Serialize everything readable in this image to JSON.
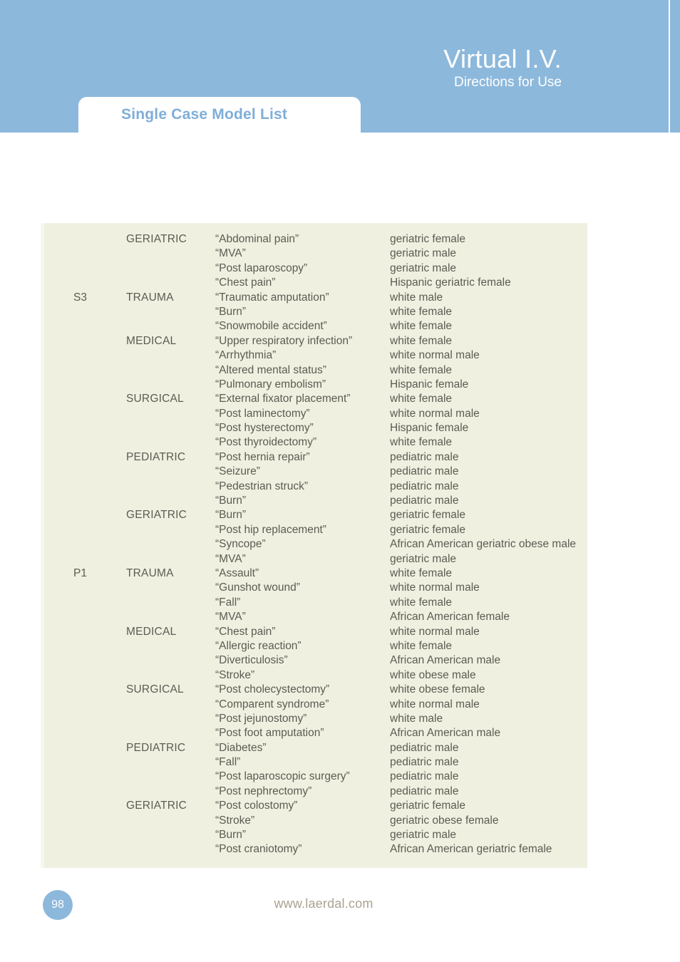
{
  "header": {
    "brand_title": "Virtual I.V.",
    "brand_subtitle": "Directions for Use",
    "tab_label": "Single Case Model List",
    "background_color": "#8cb8dc",
    "tab_text_color": "#7faed8"
  },
  "footer": {
    "page_number": "98",
    "site_url": "www.laerdal.com",
    "badge_color": "#8cb8dc"
  },
  "table": {
    "background_color": "#f0f0e1",
    "text_color": "#5b5b52",
    "rows": [
      {
        "code": "",
        "category": "GERIATRIC",
        "case": "“Abdominal pain”",
        "description": "geriatric female"
      },
      {
        "code": "",
        "category": "",
        "case": "“MVA”",
        "description": "geriatric male"
      },
      {
        "code": "",
        "category": "",
        "case": "“Post laparoscopy”",
        "description": "geriatric male"
      },
      {
        "code": "",
        "category": "",
        "case": "“Chest pain”",
        "description": "Hispanic geriatric female"
      },
      {
        "code": "S3",
        "category": "TRAUMA",
        "case": "“Traumatic amputation”",
        "description": "white male"
      },
      {
        "code": "",
        "category": "",
        "case": "“Burn”",
        "description": "white female"
      },
      {
        "code": "",
        "category": "",
        "case": "“Snowmobile accident”",
        "description": "white female"
      },
      {
        "code": "",
        "category": "MEDICAL",
        "case": "“Upper respiratory infection”",
        "description": "white female"
      },
      {
        "code": "",
        "category": "",
        "case": "“Arrhythmia”",
        "description": "white normal male"
      },
      {
        "code": "",
        "category": "",
        "case": "“Altered mental status”",
        "description": "white female"
      },
      {
        "code": "",
        "category": "",
        "case": "“Pulmonary embolism”",
        "description": "Hispanic female"
      },
      {
        "code": "",
        "category": "SURGICAL",
        "case": "“External fixator placement”",
        "description": "white female"
      },
      {
        "code": "",
        "category": "",
        "case": "“Post laminectomy”",
        "description": "white normal male"
      },
      {
        "code": "",
        "category": "",
        "case": "“Post hysterectomy”",
        "description": "Hispanic female"
      },
      {
        "code": "",
        "category": "",
        "case": "“Post thyroidectomy”",
        "description": "white female"
      },
      {
        "code": "",
        "category": "PEDIATRIC",
        "case": "“Post hernia repair”",
        "description": "pediatric male"
      },
      {
        "code": "",
        "category": "",
        "case": "“Seizure”",
        "description": "pediatric male"
      },
      {
        "code": "",
        "category": "",
        "case": "“Pedestrian struck”",
        "description": "pediatric male"
      },
      {
        "code": "",
        "category": "",
        "case": "“Burn”",
        "description": "pediatric male"
      },
      {
        "code": "",
        "category": "GERIATRIC",
        "case": "“Burn”",
        "description": "geriatric female"
      },
      {
        "code": "",
        "category": "",
        "case": "“Post hip replacement”",
        "description": "geriatric female"
      },
      {
        "code": "",
        "category": "",
        "case": "“Syncope”",
        "description": "African American geriatric obese male"
      },
      {
        "code": "",
        "category": "",
        "case": "“MVA”",
        "description": "geriatric male"
      },
      {
        "code": "P1",
        "category": "TRAUMA",
        "case": "“Assault”",
        "description": "white female"
      },
      {
        "code": "",
        "category": "",
        "case": "“Gunshot wound”",
        "description": "white normal male"
      },
      {
        "code": "",
        "category": "",
        "case": "“Fall”",
        "description": "white female"
      },
      {
        "code": "",
        "category": "",
        "case": "“MVA”",
        "description": "African American female"
      },
      {
        "code": "",
        "category": "MEDICAL",
        "case": "“Chest pain”",
        "description": "white normal male"
      },
      {
        "code": "",
        "category": "",
        "case": "“Allergic reaction”",
        "description": "white female"
      },
      {
        "code": "",
        "category": "",
        "case": "“Diverticulosis”",
        "description": "African American male"
      },
      {
        "code": "",
        "category": "",
        "case": "“Stroke”",
        "description": "white obese male"
      },
      {
        "code": "",
        "category": "SURGICAL",
        "case": "“Post cholecystectomy”",
        "description": "white obese female"
      },
      {
        "code": "",
        "category": "",
        "case": "“Comparent syndrome”",
        "description": "white normal male"
      },
      {
        "code": "",
        "category": "",
        "case": "“Post jejunostomy”",
        "description": "white male"
      },
      {
        "code": "",
        "category": "",
        "case": "“Post foot amputation”",
        "description": "African American male"
      },
      {
        "code": "",
        "category": "PEDIATRIC",
        "case": "“Diabetes”",
        "description": "pediatric male"
      },
      {
        "code": "",
        "category": "",
        "case": "“Fall”",
        "description": "pediatric male"
      },
      {
        "code": "",
        "category": "",
        "case": "“Post laparoscopic surgery”",
        "description": "pediatric male"
      },
      {
        "code": "",
        "category": "",
        "case": "“Post nephrectomy”",
        "description": "pediatric male"
      },
      {
        "code": "",
        "category": "GERIATRIC",
        "case": "“Post colostomy”",
        "description": "geriatric female"
      },
      {
        "code": "",
        "category": "",
        "case": "“Stroke”",
        "description": "geriatric obese female"
      },
      {
        "code": "",
        "category": "",
        "case": "“Burn”",
        "description": "geriatric male"
      },
      {
        "code": "",
        "category": "",
        "case": "“Post craniotomy”",
        "description": "African American geriatric female"
      }
    ]
  }
}
